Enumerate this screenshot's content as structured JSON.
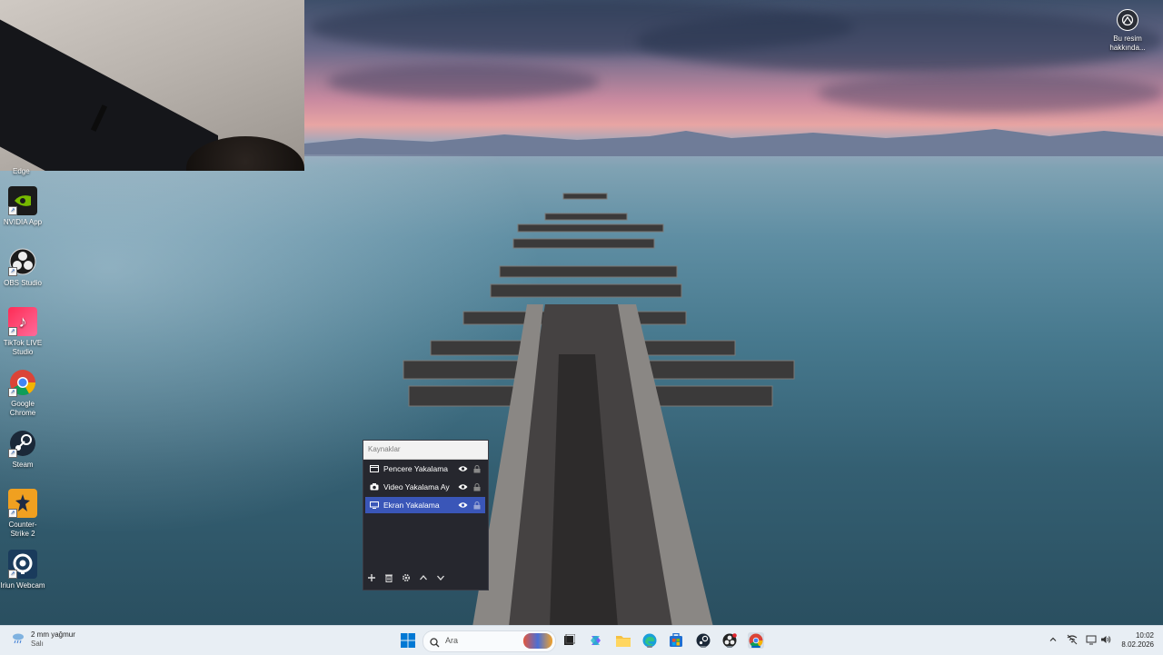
{
  "desktop": {
    "partial_label": "Edge",
    "icons": [
      {
        "label": "NVIDIA App",
        "icon": "nvidia-icon"
      },
      {
        "label": "OBS Studio",
        "icon": "obs-icon"
      },
      {
        "label": "TikTok LIVE Studio",
        "icon": "tiktok-icon"
      },
      {
        "label": "Google Chrome",
        "icon": "chrome-icon"
      },
      {
        "label": "Steam",
        "icon": "steam-icon"
      },
      {
        "label": "Counter-Strike 2",
        "icon": "counter-strike-icon"
      },
      {
        "label": "Iriun Webcam",
        "icon": "iriun-webcam-icon"
      }
    ],
    "wallpaper_info": {
      "line1": "Bu resim",
      "line2": "hakkında..."
    }
  },
  "obs_sources": {
    "title": "Kaynaklar",
    "items": [
      {
        "label": "Pencere Yakalama",
        "icon": "window-capture-icon",
        "selected": false
      },
      {
        "label": "Video Yakalama Ay",
        "icon": "camera-icon",
        "selected": false
      },
      {
        "label": "Ekran Yakalama",
        "icon": "monitor-icon",
        "selected": true
      }
    ],
    "footer_buttons": [
      "add-icon",
      "trash-icon",
      "gear-icon",
      "move-up-icon",
      "move-down-icon"
    ]
  },
  "taskbar": {
    "weather": {
      "temp": "2 mm yağmur",
      "day": "Salı"
    },
    "search_placeholder": "Ara",
    "clock": {
      "time": "10:02",
      "date": "8.02.2026"
    }
  },
  "colors": {
    "selection": "#3a56b8",
    "dock_bg": "#26272e",
    "taskbar_bg": "#e8eef4"
  }
}
